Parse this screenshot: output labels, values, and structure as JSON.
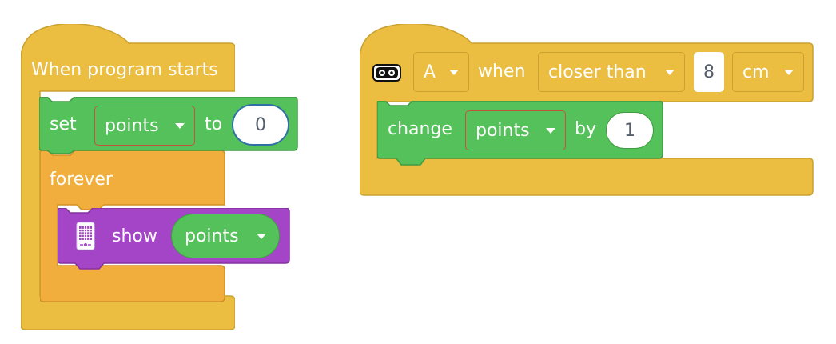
{
  "colors": {
    "events": "#ebbd40",
    "events_edge": "#c9a22f",
    "control": "#f2ae3d",
    "control_edge": "#cf9126",
    "variables": "#55c15a",
    "variables_edge": "#3e9c42",
    "display": "#a445c7",
    "display_edge": "#84329f"
  },
  "script1": {
    "hat_label": "When program starts",
    "set_block": {
      "label": "set",
      "variable": "points",
      "to_label": "to",
      "value": "0"
    },
    "forever_label": "forever",
    "show_block": {
      "icon": "hub-display-icon",
      "label": "show",
      "reporter": "points"
    }
  },
  "script2": {
    "sensor_icon": "distance-sensor-icon",
    "port": "A",
    "when_label": "when",
    "comparison": "closer than",
    "distance": "8",
    "unit": "cm",
    "change_block": {
      "label": "change",
      "variable": "points",
      "by_label": "by",
      "value": "1"
    }
  }
}
